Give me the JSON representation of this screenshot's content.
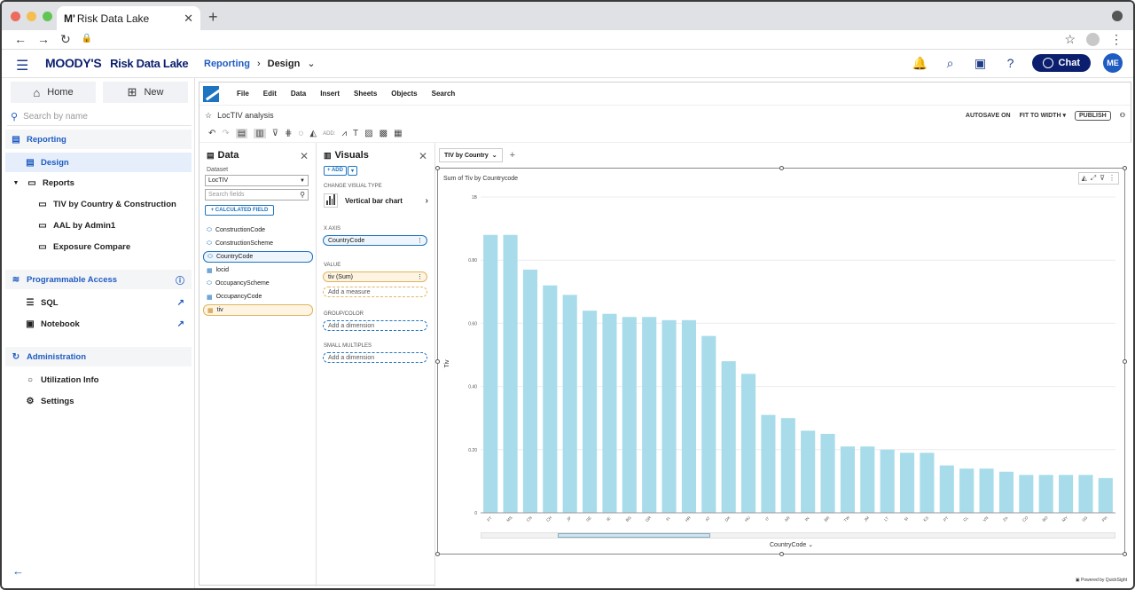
{
  "browser": {
    "tab_title": "Risk Data Lake",
    "tab_logo": "M'",
    "traffic_colors": [
      "#ec6a5e",
      "#f4bf4f",
      "#61c554"
    ]
  },
  "header": {
    "brand": "MOODY'S",
    "product": "Risk Data Lake",
    "breadcrumb_link": "Reporting",
    "breadcrumb_current": "Design",
    "chat_label": "Chat",
    "avatar_initials": "ME"
  },
  "sidebar": {
    "home_label": "Home",
    "new_label": "New",
    "search_placeholder": "Search by name",
    "reporting_label": "Reporting",
    "design_label": "Design",
    "reports_label": "Reports",
    "reports": [
      "TIV by Country & Construction",
      "AAL by Admin1",
      "Exposure Compare"
    ],
    "prog_access_label": "Programmable Access",
    "sql_label": "SQL",
    "notebook_label": "Notebook",
    "admin_label": "Administration",
    "utilization_label": "Utilization Info",
    "settings_label": "Settings"
  },
  "qs": {
    "menu": [
      "File",
      "Edit",
      "Data",
      "Insert",
      "Sheets",
      "Objects",
      "Search"
    ],
    "analysis_name": "LocTIV analysis",
    "autosave": "AUTOSAVE ON",
    "fit": "FIT TO WIDTH",
    "publish": "PUBLISH",
    "add_label": "ADD:",
    "data_pane": {
      "title": "Data",
      "dataset_label": "Dataset",
      "dataset_value": "LocTIV",
      "search_placeholder": "Search fields",
      "calc_button": "+ CALCULATED FIELD",
      "fields": [
        "ConstructionCode",
        "ConstructionScheme",
        "CountryCode",
        "locid",
        "OccupancyScheme",
        "OccupancyCode",
        "tiv"
      ]
    },
    "visuals_pane": {
      "title": "Visuals",
      "add": "+ ADD",
      "change_type_label": "CHANGE VISUAL TYPE",
      "type_name": "Vertical bar chart",
      "x_axis_label": "X AXIS",
      "x_axis_value": "CountryCode",
      "value_label": "VALUE",
      "value_value": "tiv (Sum)",
      "add_measure": "Add a measure",
      "group_label": "GROUP/COLOR",
      "add_dimension": "Add a dimension",
      "small_multiples_label": "SMALL MULTIPLES",
      "add_dimension2": "Add a dimension"
    },
    "sheet_tab": "TIV by Country",
    "visual_title": "Sum of Tiv by Countrycode",
    "powered_by": "Powered by QuickSight"
  },
  "chart_data": {
    "type": "bar",
    "title": "Sum of Tiv by Countrycode",
    "xlabel": "CountryCode",
    "ylabel": "Tiv",
    "ytick_labels": [
      "0",
      "0.20",
      "0.40",
      "0.60",
      "0.80",
      "1B"
    ],
    "ylim": [
      0,
      1.0
    ],
    "categories": [
      "FT",
      "MS",
      "CN",
      "CH",
      "JP",
      "SE",
      "IE",
      "BG",
      "GR",
      "FI",
      "HR",
      "AT",
      "DK",
      "HU",
      "IT",
      "AR",
      "IN",
      "BR",
      "TW",
      "JM",
      "LT",
      "SI",
      "KS",
      "PT",
      "CL",
      "VN",
      "ZA",
      "CO",
      "BO",
      "MY",
      "SG",
      "PH"
    ],
    "values": [
      0.88,
      0.88,
      0.77,
      0.72,
      0.69,
      0.64,
      0.63,
      0.62,
      0.62,
      0.61,
      0.61,
      0.56,
      0.48,
      0.44,
      0.31,
      0.3,
      0.26,
      0.25,
      0.21,
      0.21,
      0.2,
      0.19,
      0.19,
      0.15,
      0.14,
      0.14,
      0.13,
      0.12,
      0.12,
      0.12,
      0.12,
      0.11
    ],
    "bar_color": "#a8dcea",
    "grid": true,
    "legend": "none"
  }
}
